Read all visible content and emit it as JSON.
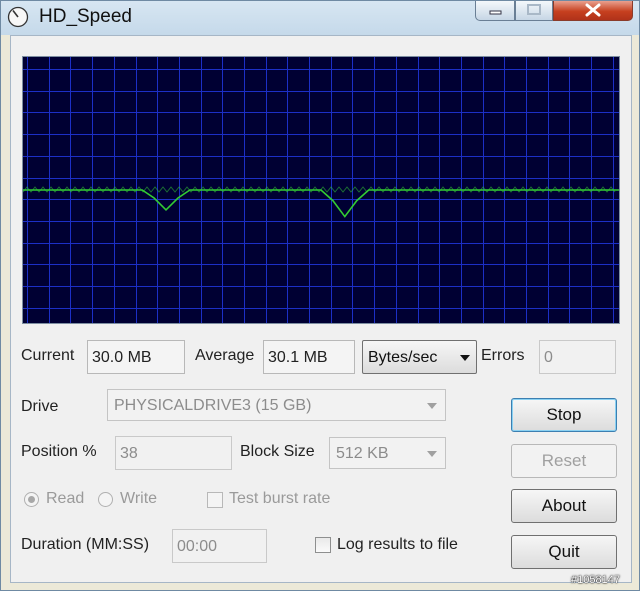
{
  "window": {
    "title": "HD_Speed"
  },
  "chart_data": {
    "type": "line",
    "x": [
      0,
      5,
      10,
      15,
      20,
      22,
      24,
      26,
      28,
      30,
      35,
      40,
      45,
      50,
      52,
      54,
      56,
      58,
      60,
      65,
      70,
      75,
      80,
      85,
      90,
      95,
      100
    ],
    "values": [
      100,
      100,
      100,
      100,
      100,
      94,
      85,
      94,
      100,
      100,
      100,
      100,
      100,
      100,
      92,
      80,
      92,
      100,
      100,
      100,
      100,
      100,
      100,
      100,
      100,
      100,
      100
    ],
    "xlim": [
      0,
      100
    ],
    "ylim": [
      0,
      200
    ],
    "grid": true
  },
  "stats": {
    "current_label": "Current",
    "current_value": "30.0 MB",
    "average_label": "Average",
    "average_value": "30.1 MB",
    "units_value": "Bytes/sec",
    "errors_label": "Errors",
    "errors_value": "0"
  },
  "settings": {
    "drive_label": "Drive",
    "drive_value": "PHYSICALDRIVE3 (15 GB)",
    "position_label": "Position %",
    "position_value": "38",
    "block_label": "Block Size",
    "block_value": "512 KB",
    "read_label": "Read",
    "write_label": "Write",
    "burst_label": "Test burst rate",
    "duration_label": "Duration (MM:SS)",
    "duration_value": "00:00",
    "log_label": "Log results to file"
  },
  "buttons": {
    "stop": "Stop",
    "reset": "Reset",
    "about": "About",
    "quit": "Quit"
  },
  "watermark": "#1058147",
  "colors": {
    "graph_bg": "#000033",
    "grid": "#1c2fc7",
    "trace": "#33cc33"
  }
}
